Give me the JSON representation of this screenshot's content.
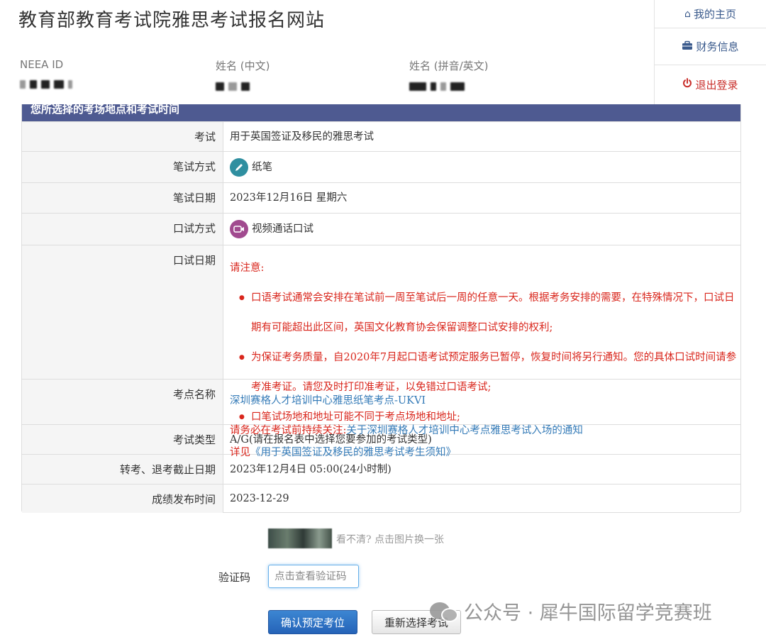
{
  "header": {
    "site_title": "教育部教育考试院雅思考试报名网站",
    "neea_id_label": "NEEA ID",
    "name_cn_label": "姓名 (中文)",
    "name_en_label": "姓名 (拼音/英文)"
  },
  "side_menu": {
    "home": "我的主页",
    "finance": "财务信息",
    "logout": "退出登录"
  },
  "panel": {
    "heading": "您所选择的考场地点和考试时间",
    "rows": {
      "exam": {
        "label": "考试",
        "value": "用于英国签证及移民的雅思考试"
      },
      "written_mode": {
        "label": "笔试方式",
        "value": "纸笔"
      },
      "written_date": {
        "label": "笔试日期",
        "value": "2023年12月16日 星期六"
      },
      "oral_mode": {
        "label": "口试方式",
        "value": "视频通话口试"
      },
      "oral_date": {
        "label": "口试日期",
        "notice_title": "请注意:",
        "items": [
          "口语考试通常会安排在笔试前一周至笔试后一周的任意一天。根据考务安排的需要，在特殊情况下，口试日期有可能超出此区间，英国文化教育协会保留调整口试安排的权利;",
          "为保证考务质量，自2020年7月起口语考试预定服务已暂停，恢复时间将另行通知。您的具体口试时间请参考准考证。请您及时打印准考证，以免错过口语考试;",
          "口笔试场地和地址可能不同于考点场地和地址;"
        ],
        "detail_prefix": "详见",
        "detail_link": "《用于英国签证及移民的雅思考试考生须知》"
      },
      "center": {
        "label": "考点名称",
        "name": "深圳赛格人才培训中心雅思纸笔考点-UKVI",
        "notice_prefix": "请务必在考试前持续关注:",
        "notice_link": "关于深圳赛格人才培训中心考点雅思考试入场的通知"
      },
      "exam_type": {
        "label": "考试类型",
        "value": "A/G(请在报名表中选择您要参加的考试类型)"
      },
      "deadline": {
        "label": "转考、退考截止日期",
        "value": "2023年12月4日 05:00(24小时制)"
      },
      "result_date": {
        "label": "成绩发布时间",
        "value": "2023-12-29"
      }
    }
  },
  "captcha": {
    "tip": "看不清? 点击图片换一张",
    "label": "验证码",
    "placeholder": "点击查看验证码"
  },
  "buttons": {
    "confirm": "确认预定考位",
    "reselect": "重新选择考试"
  },
  "watermark": {
    "text": "公众号 · 犀牛国际留学竞赛班"
  },
  "icons": {
    "home": "home-icon",
    "finance": "briefcase-icon",
    "logout": "power-icon",
    "pen": "pencil-icon",
    "video": "video-camera-icon"
  },
  "colors": {
    "panel_header": "#4e5a91",
    "link": "#337ab7",
    "warning": "#d9261c",
    "primary_button": "#2563b8"
  }
}
